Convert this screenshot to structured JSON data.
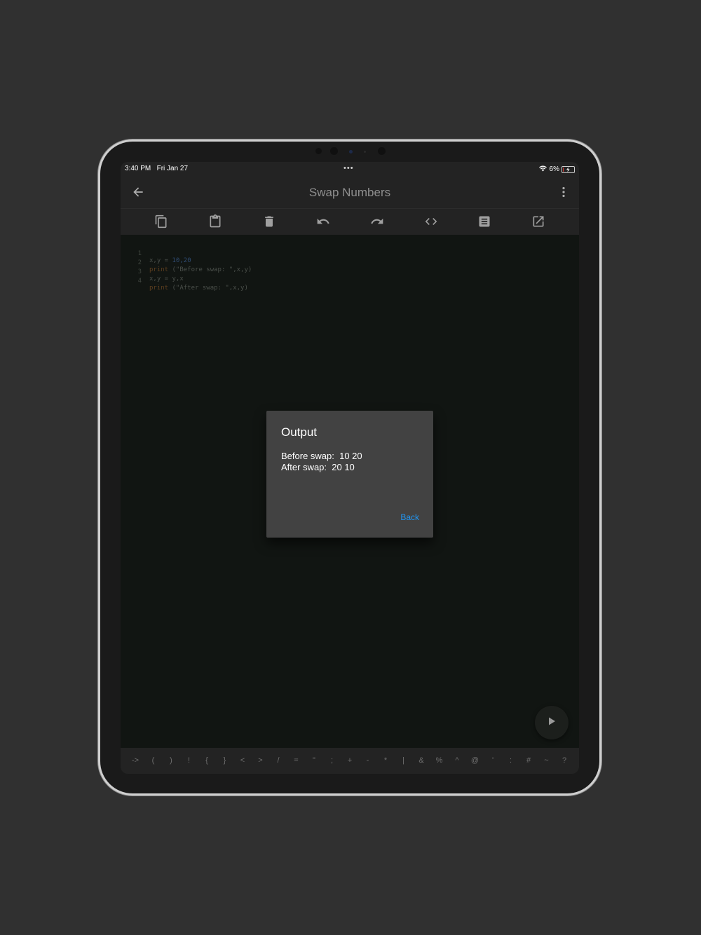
{
  "status": {
    "time": "3:40 PM",
    "date": "Fri Jan 27",
    "multitask_dots": "•••",
    "battery_percent": "6%",
    "battery_level": 0.06,
    "wifi_icon": "wifi-icon",
    "battery_icon": "battery-charging-icon"
  },
  "appbar": {
    "title": "Swap Numbers",
    "back_icon": "arrow-back-icon",
    "menu_icon": "more-vert-icon"
  },
  "toolbar": {
    "icons": [
      "copy-icon",
      "paste-icon",
      "delete-icon",
      "undo-icon",
      "redo-icon",
      "code-icon",
      "notes-icon",
      "open-external-icon"
    ]
  },
  "editor": {
    "line_numbers": [
      "1",
      "2",
      "3",
      "4"
    ],
    "lines": [
      {
        "a": "x,y = ",
        "num": "10,20"
      },
      {
        "kw": "print",
        "rest": " (\"Before swap: \",x,y)"
      },
      {
        "a": "x,y = y,x"
      },
      {
        "kw": "print",
        "rest": " (\"After swap: \",x,y)"
      }
    ]
  },
  "run_button": {
    "icon": "play-icon"
  },
  "symbols": [
    "->",
    "(",
    ")",
    "!",
    "{",
    "}",
    "<",
    ">",
    "/",
    "=",
    "\"",
    ";",
    "+",
    "-",
    "*",
    "|",
    "&",
    "%",
    "^",
    "@",
    "'",
    ":",
    "#",
    "~",
    "?"
  ],
  "dialog": {
    "title": "Output",
    "line1": "Before swap:  10 20",
    "line2": "After swap:  20 10",
    "back_label": "Back"
  },
  "colors": {
    "accent": "#2196f3",
    "dialog_bg": "#424242",
    "editor_bg": "#111512",
    "bar_bg": "#232323",
    "battery_low": "#e53935"
  }
}
